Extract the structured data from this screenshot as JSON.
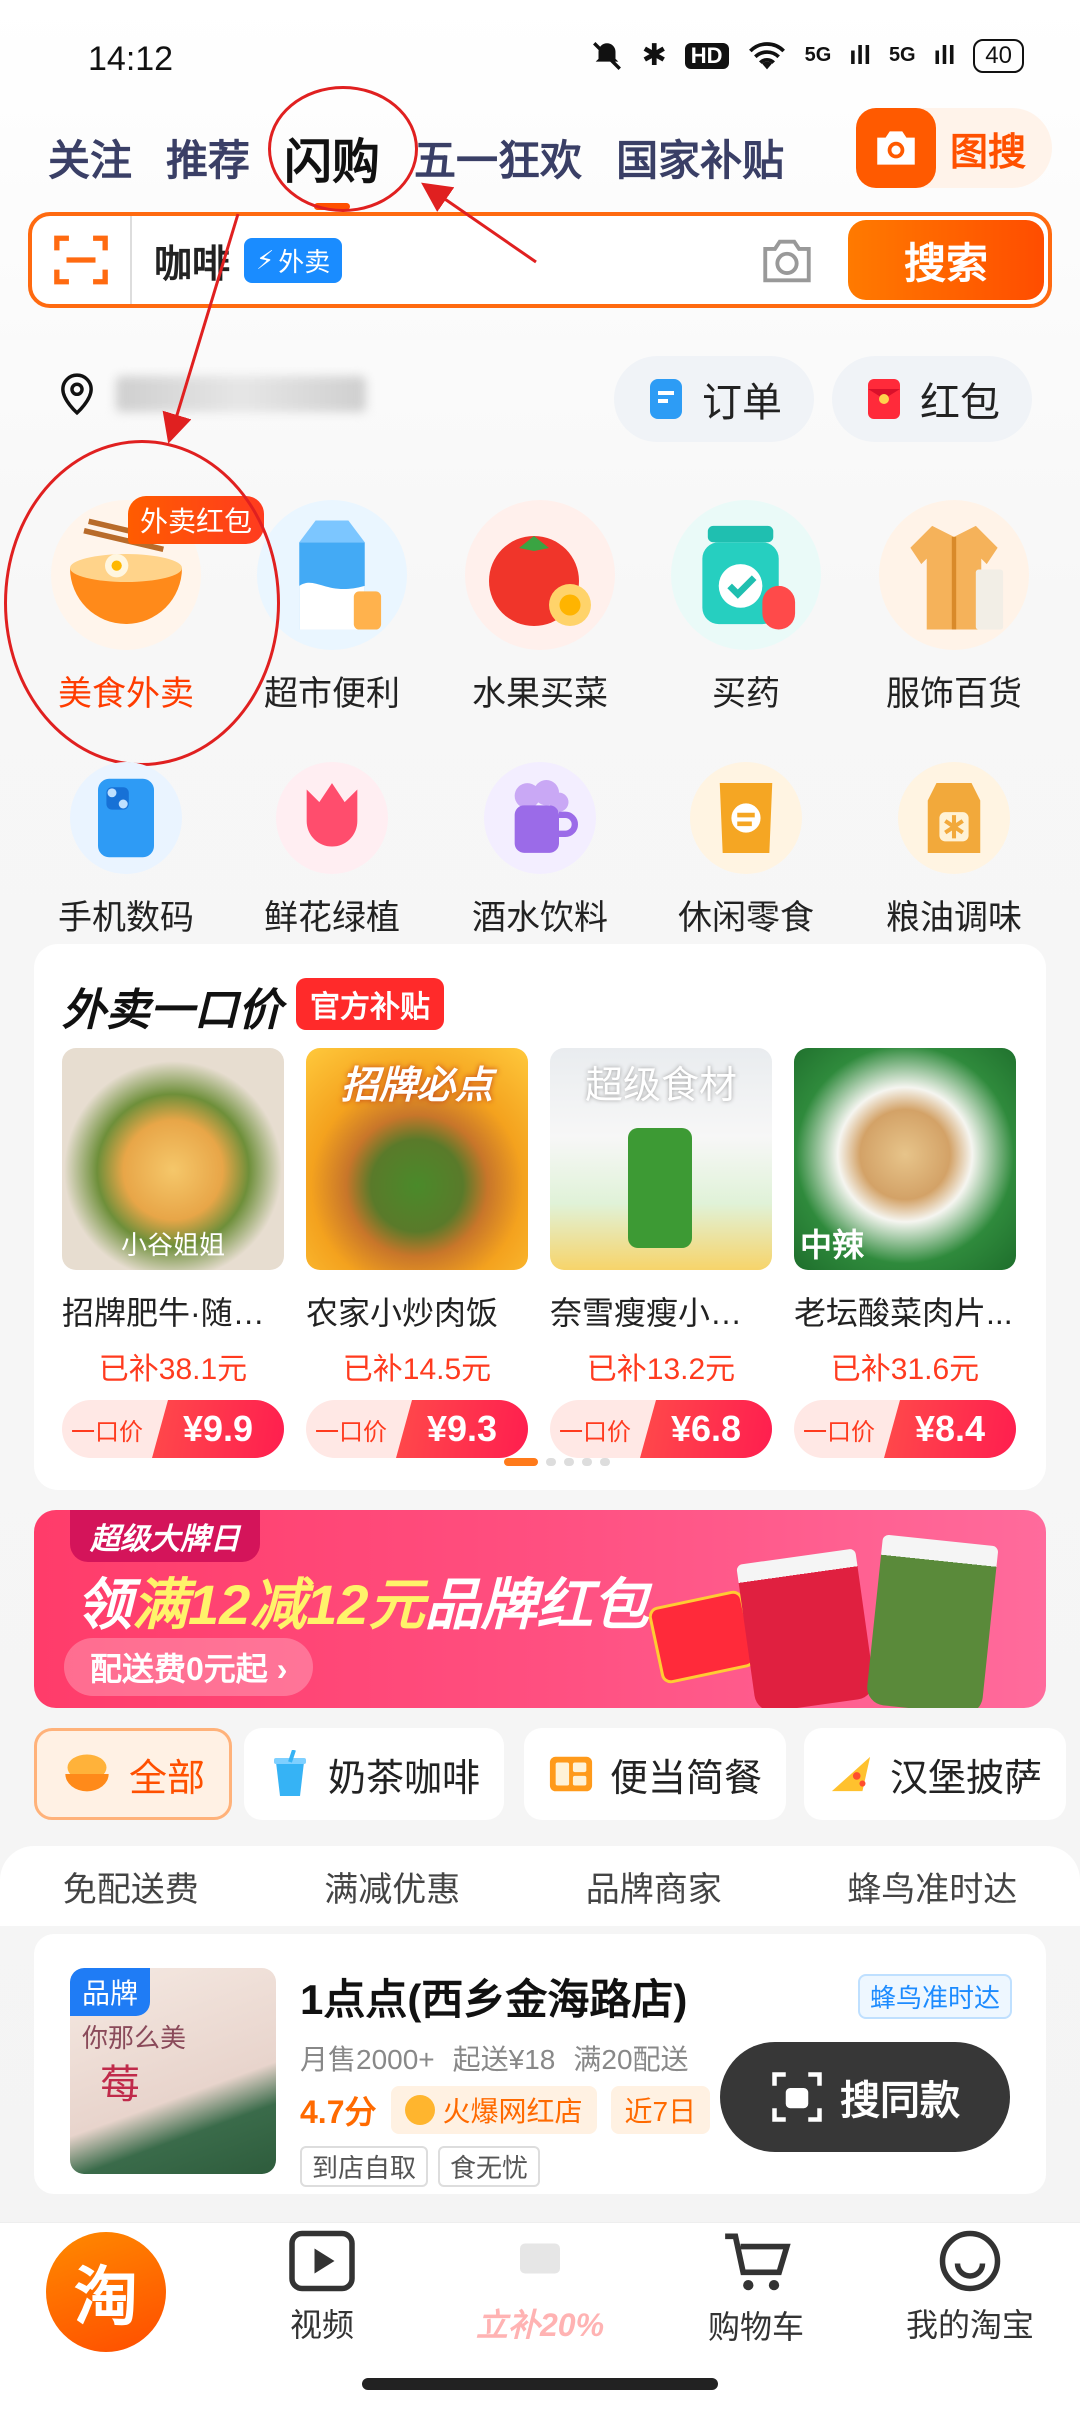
{
  "status": {
    "time": "14:12",
    "network": "5G",
    "battery": "40"
  },
  "tabs": [
    {
      "label": "关注"
    },
    {
      "label": "推荐"
    },
    {
      "label": "闪购"
    },
    {
      "label": "五一狂欢"
    },
    {
      "label": "国家补贴"
    }
  ],
  "image_search": {
    "label": "图搜"
  },
  "search": {
    "query": "咖啡",
    "tag": "外卖",
    "button": "搜索"
  },
  "location": {
    "shortcut1": "订单",
    "shortcut2": "红包"
  },
  "categories_row1": [
    {
      "label": "美食外卖",
      "badge": "外卖红包"
    },
    {
      "label": "超市便利"
    },
    {
      "label": "水果买菜"
    },
    {
      "label": "买药"
    },
    {
      "label": "服饰百货"
    }
  ],
  "categories_row2": [
    {
      "label": "手机数码"
    },
    {
      "label": "鲜花绿植"
    },
    {
      "label": "酒水饮料"
    },
    {
      "label": "休闲零食"
    },
    {
      "label": "粮油调味"
    }
  ],
  "deal": {
    "title": "外卖一口价",
    "badge": "官方补贴",
    "price_prefix": "一口价",
    "items": [
      {
        "name": "招牌肥牛·随心...",
        "subsidy": "已补38.1元",
        "price": "¥9.9",
        "img_text": "小谷姐姐"
      },
      {
        "name": "农家小炒肉饭",
        "subsidy": "已补14.5元",
        "price": "¥9.3",
        "img_text": "招牌必点"
      },
      {
        "name": "奈雪瘦瘦小绿瓶",
        "subsidy": "已补13.2元",
        "price": "¥6.8",
        "img_text": "超级食材"
      },
      {
        "name": "老坛酸菜肉片...",
        "subsidy": "已补31.6元",
        "price": "¥8.4",
        "img_text": "中辣"
      }
    ]
  },
  "banner": {
    "tag": "超级大牌日",
    "main_pre": "领",
    "main_hl": "满12减12元",
    "main_post": "品牌红包",
    "sub": "配送费0元起 ›"
  },
  "chips": [
    {
      "label": "全部"
    },
    {
      "label": "奶茶咖啡"
    },
    {
      "label": "便当简餐"
    },
    {
      "label": "汉堡披萨"
    }
  ],
  "filters": [
    {
      "label": "免配送费"
    },
    {
      "label": "满减优惠"
    },
    {
      "label": "品牌商家"
    },
    {
      "label": "蜂鸟准时达"
    }
  ],
  "store": {
    "brand": "品牌",
    "name": "1点点(西乡金海路店)",
    "tag": "蜂鸟准时达",
    "monthly": "月售2000+",
    "min_order": "起送¥18",
    "delivery": "满20配送",
    "score": "4.7分",
    "hot": "火爆网红店",
    "rank": "近7日",
    "tags": [
      "到店自取",
      "食无忧"
    ],
    "img_text": "你那么美",
    "img_char": "莓"
  },
  "float_button": {
    "label": "搜同款"
  },
  "bottom_nav": [
    {
      "label": "淘"
    },
    {
      "label": "视频"
    },
    {
      "label": "立补20%"
    },
    {
      "label": "购物车"
    },
    {
      "label": "我的淘宝"
    }
  ],
  "colors": {
    "accent": "#ff5000",
    "annotation": "#e02020"
  }
}
